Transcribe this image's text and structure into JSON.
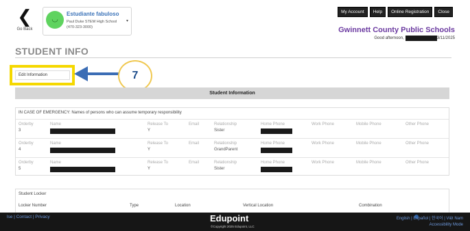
{
  "header": {
    "back_label": "Go Back",
    "student": {
      "name": "Estudiante fabuloso",
      "school": "Paul Duke STEM High School",
      "phone": "(470-323-3000)"
    },
    "buttons": [
      "My Account",
      "Help",
      "Online Registration",
      "Close"
    ],
    "district": "Gwinnett County Public Schools",
    "greeting": "Good afternoon,",
    "date_suffix": "3/11/2025"
  },
  "page_title": "STUDENT INFO",
  "edit_button_label": "Edit Information",
  "step_number": "7",
  "student_information_header": "Student Information",
  "emergency": {
    "title": "IN CASE OF EMERGENCY: Names of persons who can assume temporary responsibility",
    "columns": [
      "Orderby",
      "Name",
      "Release To",
      "Email",
      "Relationship",
      "Home Phone",
      "Work Phone",
      "Mobile Phone",
      "Other Phone"
    ],
    "rows": [
      {
        "orderby": "3",
        "release": "Y",
        "relationship": "Sister"
      },
      {
        "orderby": "4",
        "release": "Y",
        "relationship": "GrandParent"
      },
      {
        "orderby": "5",
        "release": "Y",
        "relationship": "Sister"
      }
    ]
  },
  "locker": {
    "title": "Student Locker",
    "columns": [
      "Locker Number",
      "Type",
      "Location",
      "Vertical Location",
      "Combination"
    ]
  },
  "footer": {
    "links": "lse | Contact | Privacy",
    "brand": "Edupoint",
    "copyright": "©Copyright 2025 Edupoint, LLC",
    "languages": "English | Español | 한국어 | Việt Nam",
    "accessibility": "Accessibility Mode"
  },
  "colors": {
    "district": "#6b3aa0",
    "highlight": "#f5d800",
    "arrow": "#3b6db5",
    "footer_bg": "#161616"
  }
}
